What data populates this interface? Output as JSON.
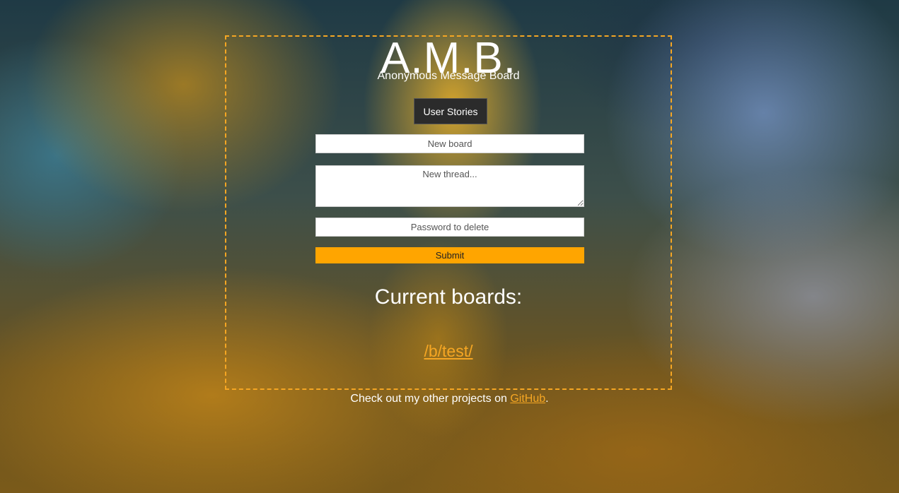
{
  "header": {
    "title": "A.M.B.",
    "subtitle": "Anonymous Message Board"
  },
  "nav": {
    "user_stories_label": "User Stories"
  },
  "form": {
    "board_placeholder": "New board",
    "thread_placeholder": "New thread...",
    "password_placeholder": "Password to delete",
    "submit_label": "Submit"
  },
  "boards": {
    "heading": "Current boards:",
    "items": [
      {
        "label": "/b/test/"
      }
    ]
  },
  "footer": {
    "text_before": "Check out my other projects on ",
    "link_label": "GitHub",
    "text_after": "."
  },
  "colors": {
    "accent": "#f5a623",
    "submit_bg": "#ffa500",
    "button_dark": "#2b2b2b"
  }
}
